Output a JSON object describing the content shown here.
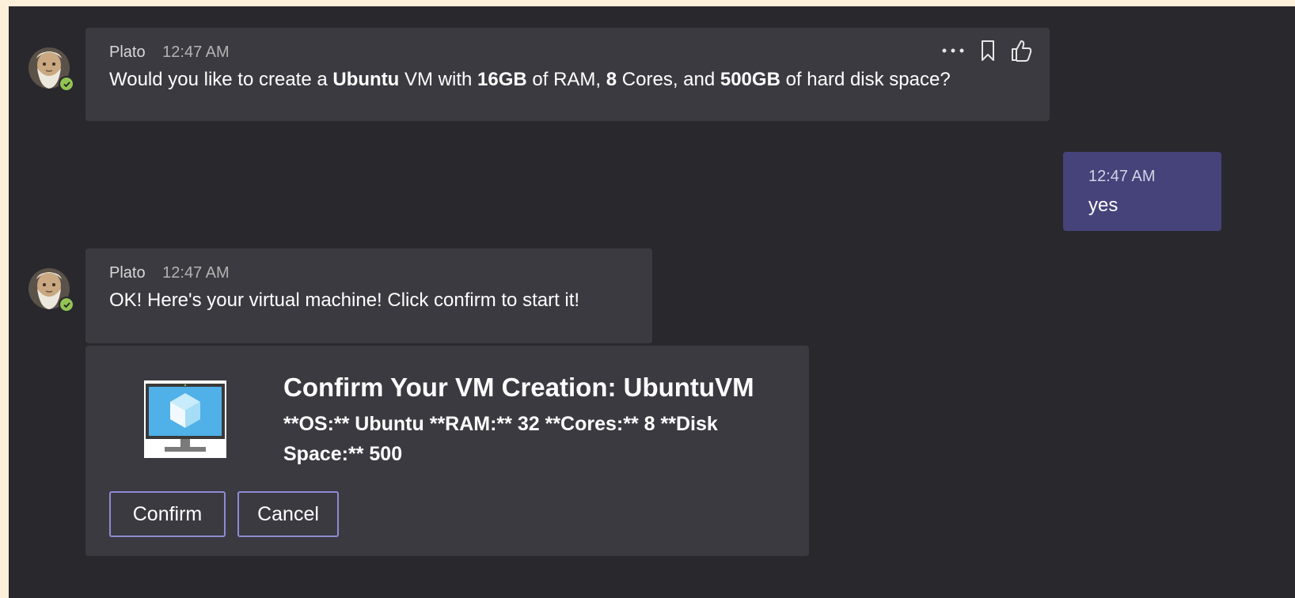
{
  "messages": [
    {
      "sender": "Plato",
      "time": "12:47 AM",
      "text_parts": [
        "Would you like to create a ",
        "Ubuntu",
        " VM with ",
        "16GB",
        " of RAM, ",
        "8",
        " Cores, and ",
        "500GB",
        " of hard disk space?"
      ]
    },
    {
      "time": "12:47 AM",
      "text": "yes"
    },
    {
      "sender": "Plato",
      "time": "12:47 AM",
      "text": "OK! Here's your virtual machine! Click confirm to start it!"
    }
  ],
  "card": {
    "title": "Confirm Your VM Creation: UbuntuVM",
    "body": "**OS:** Ubuntu **RAM:** 32 **Cores:** 8 **Disk Space:** 500",
    "confirm_label": "Confirm",
    "cancel_label": "Cancel",
    "icon": "monitor-cube-icon"
  },
  "icons": {
    "more": "more-options-icon",
    "bookmark": "bookmark-icon",
    "like": "thumbs-up-icon",
    "presence": "presence-available-icon"
  },
  "colors": {
    "background": "#29282d",
    "bubble": "#3b3a40",
    "own_bubble": "#45437a",
    "button_border": "#8d8bd3",
    "presence": "#92c353"
  }
}
